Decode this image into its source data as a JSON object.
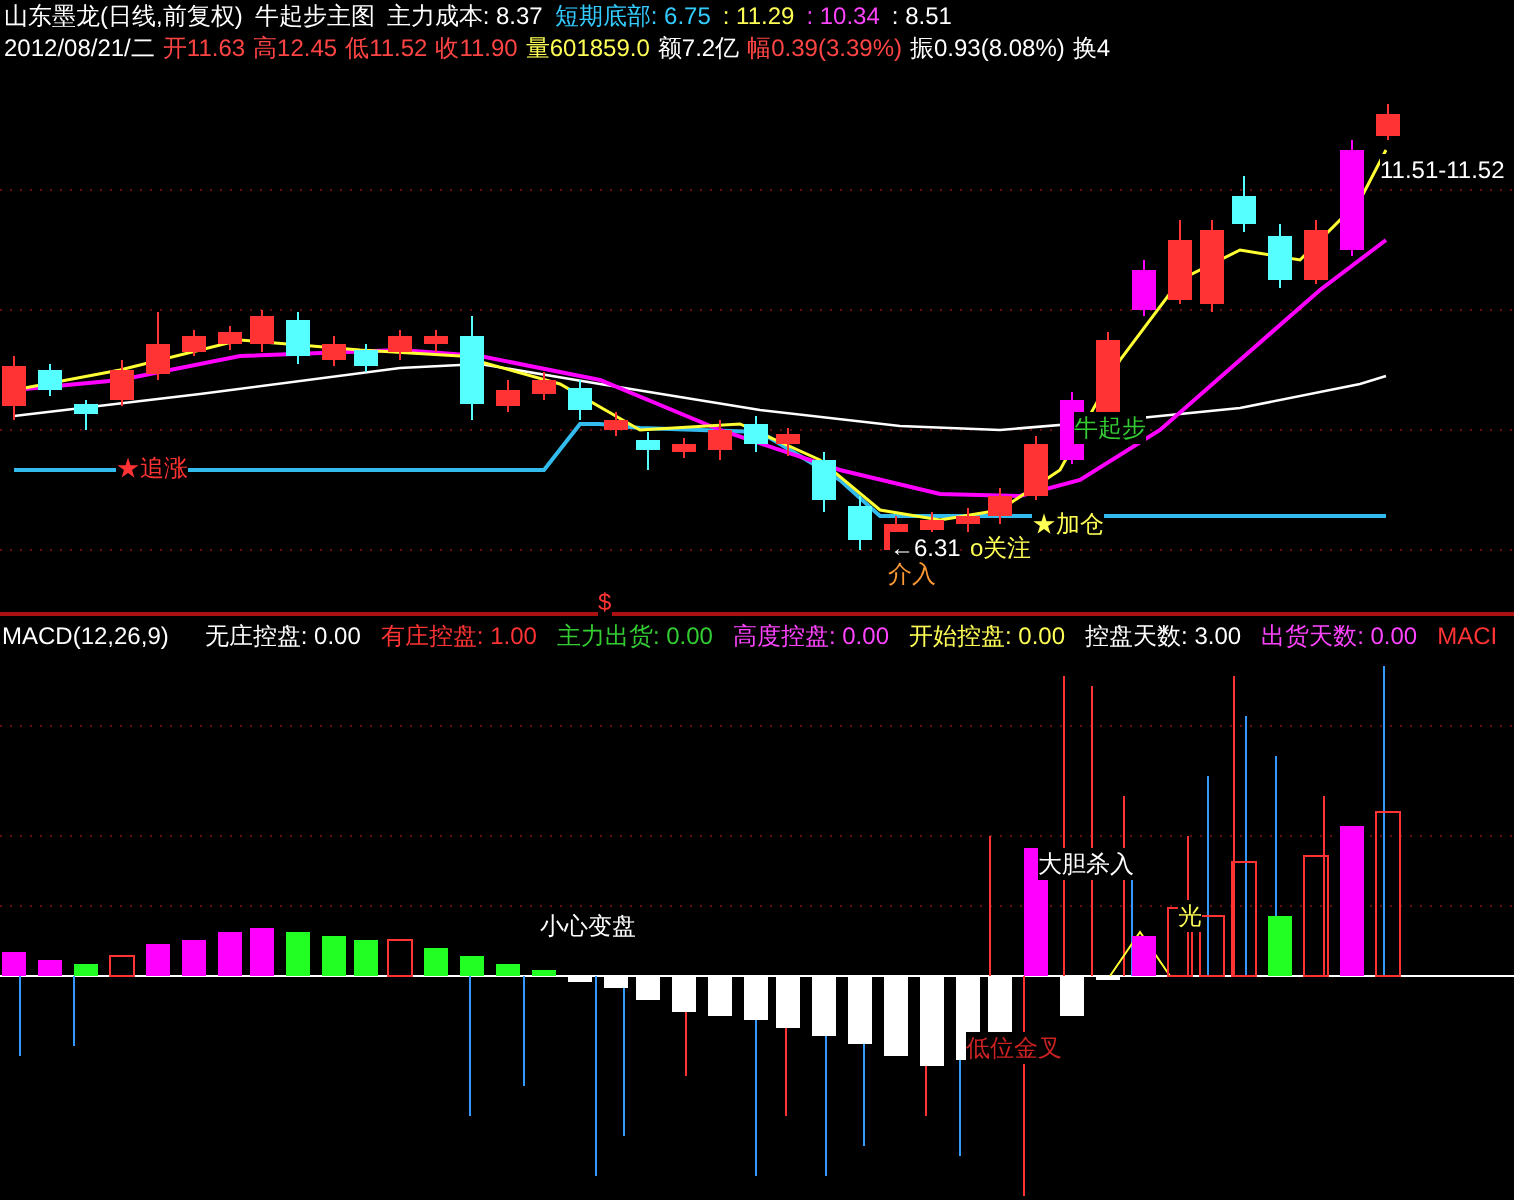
{
  "header": {
    "line1": [
      {
        "text": "山东墨龙(日线,前复权)",
        "color": "#ffffff"
      },
      {
        "text": "牛起步主图",
        "color": "#ffffff"
      },
      {
        "text": "主力成本: 8.37",
        "color": "#ffffff"
      },
      {
        "text": "短期底部: 6.75",
        "color": "#33ccff"
      },
      {
        "text": ": 11.29",
        "color": "#ffff55"
      },
      {
        "text": ": 10.34",
        "color": "#ff44ff"
      },
      {
        "text": ": 8.51",
        "color": "#ffffff"
      }
    ],
    "line2": [
      {
        "text": "2012/08/21/二",
        "color": "#ffffff"
      },
      {
        "text": "开11.63",
        "color": "#ff4444"
      },
      {
        "text": "高12.45",
        "color": "#ff4444"
      },
      {
        "text": "低11.52",
        "color": "#ff4444"
      },
      {
        "text": "收11.90",
        "color": "#ff4444"
      },
      {
        "text": "量601859.0",
        "color": "#ffff55"
      },
      {
        "text": "额7.2亿",
        "color": "#ffffff"
      },
      {
        "text": "幅0.39(3.39%)",
        "color": "#ff4444"
      },
      {
        "text": "振0.93(8.08%)",
        "color": "#ffffff"
      },
      {
        "text": "换4",
        "color": "#ffffff"
      }
    ]
  },
  "price_label": "11.51-11.52",
  "chart_labels": [
    {
      "text": "★追涨",
      "color": "#ff3333"
    },
    {
      "text": "牛起步",
      "color": "#33cc33"
    },
    {
      "text": "★加仓",
      "color": "#ffff55"
    },
    {
      "text": "←6.31",
      "color": "#ffffff"
    },
    {
      "text": "o关注",
      "color": "#ffff55"
    },
    {
      "text": "介入",
      "color": "#ff9933"
    },
    {
      "text": "$",
      "color": "#ff3333"
    }
  ],
  "macd": {
    "title": "MACD(12,26,9)",
    "indicators": [
      {
        "label": "无庄控盘: 0.00",
        "color": "#ffffff"
      },
      {
        "label": "有庄控盘: 1.00",
        "color": "#ff3333"
      },
      {
        "label": "主力出货: 0.00",
        "color": "#33cc33"
      },
      {
        "label": "高度控盘: 0.00",
        "color": "#ff44ff"
      },
      {
        "label": "开始控盘: 0.00",
        "color": "#ffff55"
      },
      {
        "label": "控盘天数: 3.00",
        "color": "#ffffff"
      },
      {
        "label": "出货天数: 0.00",
        "color": "#ff44ff"
      },
      {
        "label": "MACI",
        "color": "#ff3333"
      }
    ],
    "labels": [
      {
        "text": "小心变盘",
        "color": "#ffffff"
      },
      {
        "text": "大胆杀入",
        "color": "#ffffff"
      },
      {
        "text": "低位金叉",
        "color": "#cc2222"
      },
      {
        "text": "光",
        "color": "#ffff55"
      }
    ]
  }
}
